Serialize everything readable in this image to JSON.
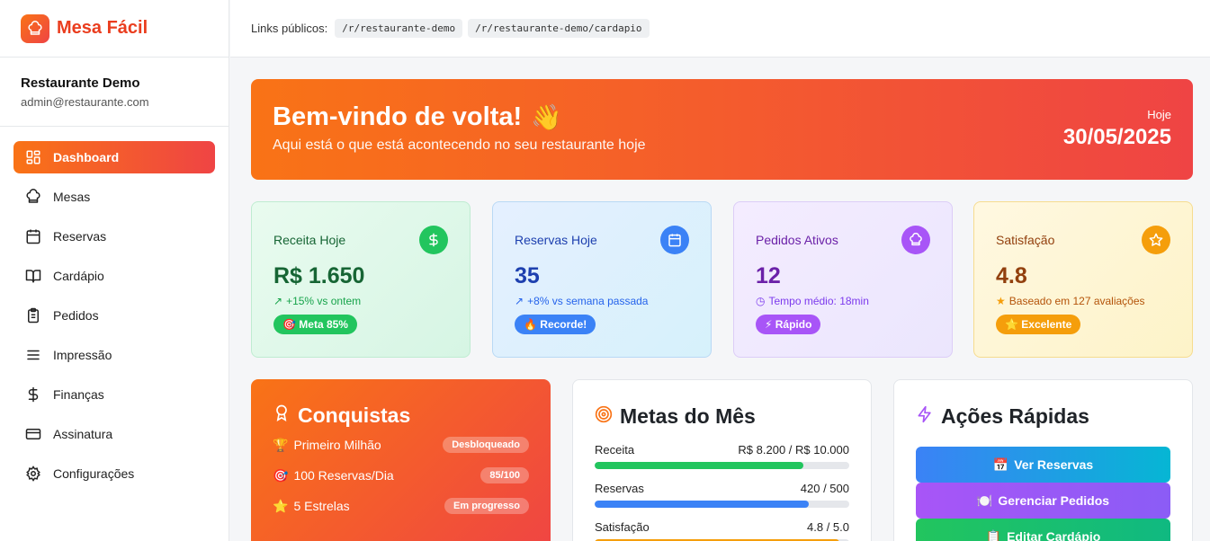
{
  "brand": {
    "name": "Mesa Fácil",
    "icon": "chef-hat-icon"
  },
  "account": {
    "name": "Restaurante Demo",
    "email": "admin@restaurante.com"
  },
  "nav": [
    {
      "label": "Dashboard",
      "icon": "grid-icon",
      "active": true
    },
    {
      "label": "Mesas",
      "icon": "chef-hat-icon"
    },
    {
      "label": "Reservas",
      "icon": "calendar-icon"
    },
    {
      "label": "Cardápio",
      "icon": "book-icon"
    },
    {
      "label": "Pedidos",
      "icon": "clipboard-icon"
    },
    {
      "label": "Impressão",
      "icon": "menu-lines-icon"
    },
    {
      "label": "Finanças",
      "icon": "dollar-icon"
    },
    {
      "label": "Assinatura",
      "icon": "credit-card-icon"
    },
    {
      "label": "Configurações",
      "icon": "gear-icon"
    }
  ],
  "topbar": {
    "label": "Links públicos:",
    "links": [
      "/r/restaurante-demo",
      "/r/restaurante-demo/cardapio"
    ]
  },
  "hero": {
    "title": "Bem-vindo de volta!",
    "emoji": "👋",
    "subtitle": "Aqui está o que está acontecendo no seu restaurante hoje",
    "date_label": "Hoje",
    "date": "30/05/2025"
  },
  "stats": [
    {
      "label": "Receita Hoje",
      "value": "R$ 1.650",
      "trend": "+15% vs ontem",
      "pill": "🎯 Meta 85%",
      "icon": "dollar-icon",
      "pill_color": "#22c55e",
      "icon_color": "#22c55e"
    },
    {
      "label": "Reservas Hoje",
      "value": "35",
      "trend": "+8% vs semana passada",
      "pill": "🔥 Recorde!",
      "icon": "calendar-icon",
      "pill_color": "#3b82f6",
      "icon_color": "#3b82f6"
    },
    {
      "label": "Pedidos Ativos",
      "value": "12",
      "trend": "Tempo médio: 18min",
      "pill": "⚡ Rápido",
      "icon": "chef-hat-icon",
      "pill_color": "#a855f7",
      "icon_color": "#a855f7"
    },
    {
      "label": "Satisfação",
      "value": "4.8",
      "trend": "Baseado em 127 avaliações",
      "pill": "⭐ Excelente",
      "icon": "star-icon",
      "pill_color": "#f59e0b",
      "icon_color": "#f59e0b"
    }
  ],
  "conquistas": {
    "title": "Conquistas",
    "items": [
      {
        "emoji": "🏆",
        "label": "Primeiro Milhão",
        "badge": "Desbloqueado"
      },
      {
        "emoji": "🎯",
        "label": "100 Reservas/Dia",
        "badge": "85/100"
      },
      {
        "emoji": "⭐",
        "label": "5 Estrelas",
        "badge": "Em progresso"
      }
    ]
  },
  "metas": {
    "title": "Metas do Mês",
    "items": [
      {
        "label": "Receita",
        "value": "R$ 8.200 / R$ 10.000",
        "progress": 0.82,
        "color": "#22c55e"
      },
      {
        "label": "Reservas",
        "value": "420 / 500",
        "progress": 0.84,
        "color": "#3b82f6"
      },
      {
        "label": "Satisfação",
        "value": "4.8 / 5.0",
        "progress": 0.96,
        "color": "#f59e0b"
      }
    ]
  },
  "acoes": {
    "title": "Ações Rápidas",
    "buttons": [
      {
        "emoji": "📅",
        "label": "Ver Reservas"
      },
      {
        "emoji": "🍽️",
        "label": "Gerenciar Pedidos"
      },
      {
        "emoji": "📋",
        "label": "Editar Cardápio"
      }
    ]
  }
}
